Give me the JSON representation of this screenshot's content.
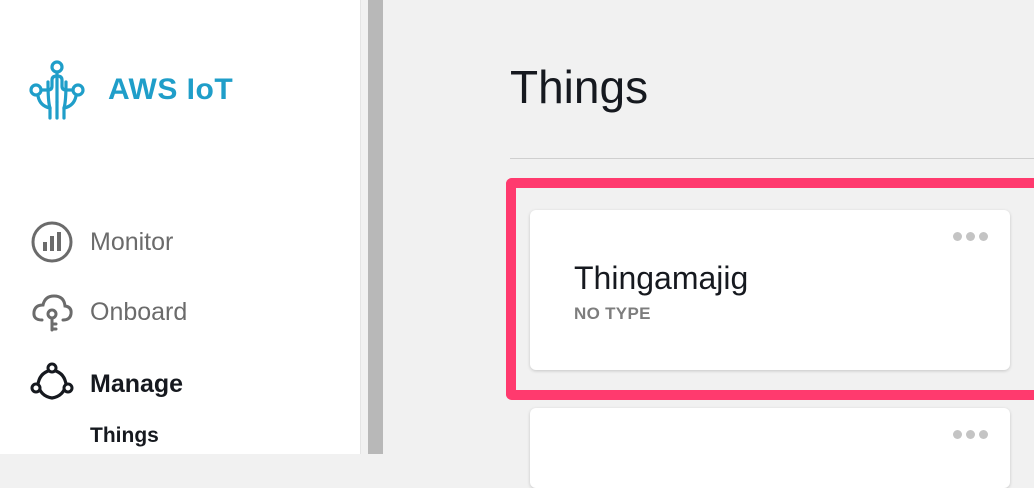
{
  "sidebar": {
    "brand": "AWS IoT",
    "items": [
      {
        "label": "Monitor",
        "icon": "bar-chart-icon"
      },
      {
        "label": "Onboard",
        "icon": "cloud-icon"
      },
      {
        "label": "Manage",
        "icon": "manage-nodes-icon"
      }
    ],
    "subitems": [
      {
        "label": "Things"
      }
    ]
  },
  "main": {
    "title": "Things",
    "cards": [
      {
        "name": "Thingamajig",
        "type": "NO TYPE"
      }
    ]
  },
  "colors": {
    "brand": "#1f9ec9",
    "highlight": "#ff3a6e",
    "text": "#16191f",
    "muted": "#7d7d7d"
  }
}
